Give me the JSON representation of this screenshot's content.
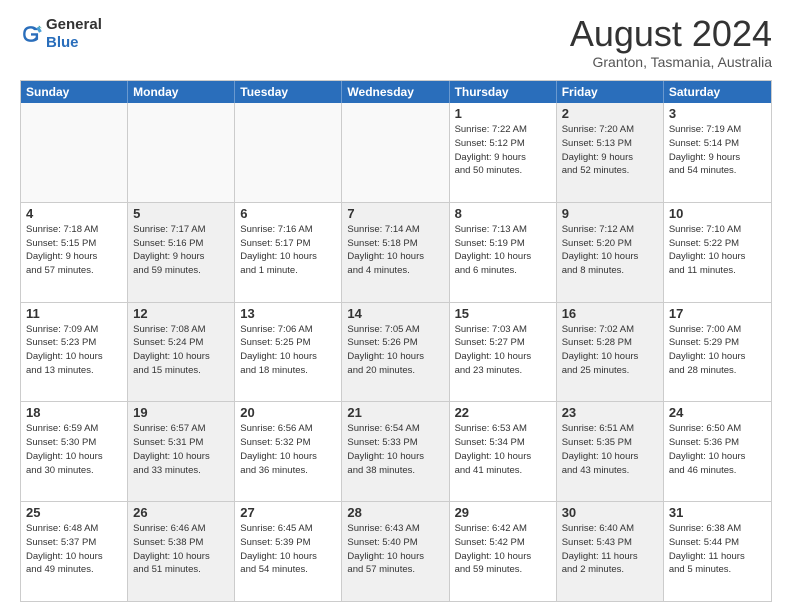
{
  "logo": {
    "general": "General",
    "blue": "Blue"
  },
  "title": "August 2024",
  "location": "Granton, Tasmania, Australia",
  "weekdays": [
    "Sunday",
    "Monday",
    "Tuesday",
    "Wednesday",
    "Thursday",
    "Friday",
    "Saturday"
  ],
  "rows": [
    [
      {
        "day": "",
        "info": "",
        "empty": true
      },
      {
        "day": "",
        "info": "",
        "empty": true
      },
      {
        "day": "",
        "info": "",
        "empty": true
      },
      {
        "day": "",
        "info": "",
        "empty": true
      },
      {
        "day": "1",
        "info": "Sunrise: 7:22 AM\nSunset: 5:12 PM\nDaylight: 9 hours\nand 50 minutes.",
        "shaded": false
      },
      {
        "day": "2",
        "info": "Sunrise: 7:20 AM\nSunset: 5:13 PM\nDaylight: 9 hours\nand 52 minutes.",
        "shaded": true
      },
      {
        "day": "3",
        "info": "Sunrise: 7:19 AM\nSunset: 5:14 PM\nDaylight: 9 hours\nand 54 minutes.",
        "shaded": false
      }
    ],
    [
      {
        "day": "4",
        "info": "Sunrise: 7:18 AM\nSunset: 5:15 PM\nDaylight: 9 hours\nand 57 minutes.",
        "shaded": false
      },
      {
        "day": "5",
        "info": "Sunrise: 7:17 AM\nSunset: 5:16 PM\nDaylight: 9 hours\nand 59 minutes.",
        "shaded": true
      },
      {
        "day": "6",
        "info": "Sunrise: 7:16 AM\nSunset: 5:17 PM\nDaylight: 10 hours\nand 1 minute.",
        "shaded": false
      },
      {
        "day": "7",
        "info": "Sunrise: 7:14 AM\nSunset: 5:18 PM\nDaylight: 10 hours\nand 4 minutes.",
        "shaded": true
      },
      {
        "day": "8",
        "info": "Sunrise: 7:13 AM\nSunset: 5:19 PM\nDaylight: 10 hours\nand 6 minutes.",
        "shaded": false
      },
      {
        "day": "9",
        "info": "Sunrise: 7:12 AM\nSunset: 5:20 PM\nDaylight: 10 hours\nand 8 minutes.",
        "shaded": true
      },
      {
        "day": "10",
        "info": "Sunrise: 7:10 AM\nSunset: 5:22 PM\nDaylight: 10 hours\nand 11 minutes.",
        "shaded": false
      }
    ],
    [
      {
        "day": "11",
        "info": "Sunrise: 7:09 AM\nSunset: 5:23 PM\nDaylight: 10 hours\nand 13 minutes.",
        "shaded": false
      },
      {
        "day": "12",
        "info": "Sunrise: 7:08 AM\nSunset: 5:24 PM\nDaylight: 10 hours\nand 15 minutes.",
        "shaded": true
      },
      {
        "day": "13",
        "info": "Sunrise: 7:06 AM\nSunset: 5:25 PM\nDaylight: 10 hours\nand 18 minutes.",
        "shaded": false
      },
      {
        "day": "14",
        "info": "Sunrise: 7:05 AM\nSunset: 5:26 PM\nDaylight: 10 hours\nand 20 minutes.",
        "shaded": true
      },
      {
        "day": "15",
        "info": "Sunrise: 7:03 AM\nSunset: 5:27 PM\nDaylight: 10 hours\nand 23 minutes.",
        "shaded": false
      },
      {
        "day": "16",
        "info": "Sunrise: 7:02 AM\nSunset: 5:28 PM\nDaylight: 10 hours\nand 25 minutes.",
        "shaded": true
      },
      {
        "day": "17",
        "info": "Sunrise: 7:00 AM\nSunset: 5:29 PM\nDaylight: 10 hours\nand 28 minutes.",
        "shaded": false
      }
    ],
    [
      {
        "day": "18",
        "info": "Sunrise: 6:59 AM\nSunset: 5:30 PM\nDaylight: 10 hours\nand 30 minutes.",
        "shaded": false
      },
      {
        "day": "19",
        "info": "Sunrise: 6:57 AM\nSunset: 5:31 PM\nDaylight: 10 hours\nand 33 minutes.",
        "shaded": true
      },
      {
        "day": "20",
        "info": "Sunrise: 6:56 AM\nSunset: 5:32 PM\nDaylight: 10 hours\nand 36 minutes.",
        "shaded": false
      },
      {
        "day": "21",
        "info": "Sunrise: 6:54 AM\nSunset: 5:33 PM\nDaylight: 10 hours\nand 38 minutes.",
        "shaded": true
      },
      {
        "day": "22",
        "info": "Sunrise: 6:53 AM\nSunset: 5:34 PM\nDaylight: 10 hours\nand 41 minutes.",
        "shaded": false
      },
      {
        "day": "23",
        "info": "Sunrise: 6:51 AM\nSunset: 5:35 PM\nDaylight: 10 hours\nand 43 minutes.",
        "shaded": true
      },
      {
        "day": "24",
        "info": "Sunrise: 6:50 AM\nSunset: 5:36 PM\nDaylight: 10 hours\nand 46 minutes.",
        "shaded": false
      }
    ],
    [
      {
        "day": "25",
        "info": "Sunrise: 6:48 AM\nSunset: 5:37 PM\nDaylight: 10 hours\nand 49 minutes.",
        "shaded": false
      },
      {
        "day": "26",
        "info": "Sunrise: 6:46 AM\nSunset: 5:38 PM\nDaylight: 10 hours\nand 51 minutes.",
        "shaded": true
      },
      {
        "day": "27",
        "info": "Sunrise: 6:45 AM\nSunset: 5:39 PM\nDaylight: 10 hours\nand 54 minutes.",
        "shaded": false
      },
      {
        "day": "28",
        "info": "Sunrise: 6:43 AM\nSunset: 5:40 PM\nDaylight: 10 hours\nand 57 minutes.",
        "shaded": true
      },
      {
        "day": "29",
        "info": "Sunrise: 6:42 AM\nSunset: 5:42 PM\nDaylight: 10 hours\nand 59 minutes.",
        "shaded": false
      },
      {
        "day": "30",
        "info": "Sunrise: 6:40 AM\nSunset: 5:43 PM\nDaylight: 11 hours\nand 2 minutes.",
        "shaded": true
      },
      {
        "day": "31",
        "info": "Sunrise: 6:38 AM\nSunset: 5:44 PM\nDaylight: 11 hours\nand 5 minutes.",
        "shaded": false
      }
    ]
  ]
}
